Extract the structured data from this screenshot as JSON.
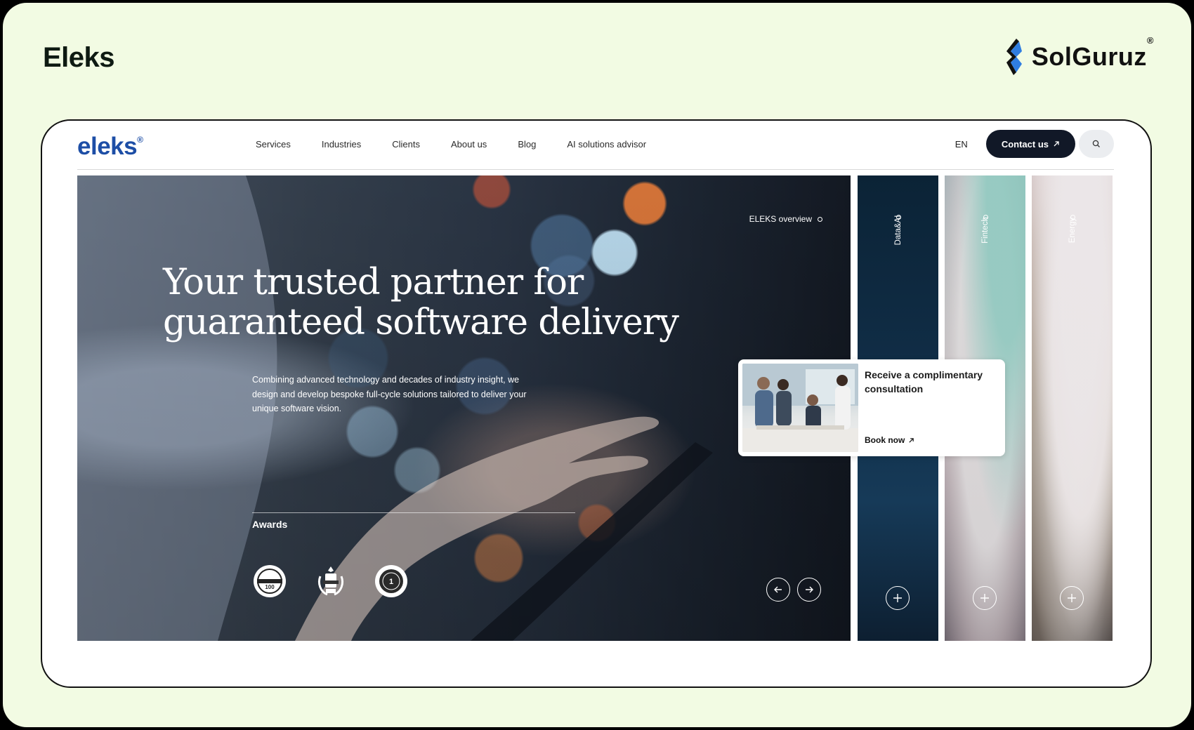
{
  "header": {
    "title": "Eleks"
  },
  "solguruz": {
    "name": "SolGuruz",
    "reg": "®"
  },
  "site": {
    "logo": "eleks",
    "logo_mark": "®",
    "nav": [
      "Services",
      "Industries",
      "Clients",
      "About us",
      "Blog",
      "AI solutions advisor"
    ],
    "lang": "EN",
    "contact_label": "Contact us"
  },
  "hero": {
    "title_line1": "Your trusted partner for",
    "title_line2": "guaranteed software delivery",
    "description": "Combining advanced technology and decades of industry insight, we design and develop bespoke full-cycle solutions tailored to deliver your unique software vision.",
    "overview_label": "ELEKS overview",
    "awards_title": "Awards",
    "awards": [
      "outsourcing-100-award-icon",
      "gold-award-icon",
      "number-one-award-icon"
    ]
  },
  "panels": [
    "Data&AI",
    "Fintech",
    "Energy"
  ],
  "consult": {
    "title": "Receive a complimentary consultation",
    "link": "Book now"
  },
  "colors": {
    "background": "#f2fbe3",
    "brand_blue": "#1d4ea6",
    "contact_button": "#111827"
  }
}
